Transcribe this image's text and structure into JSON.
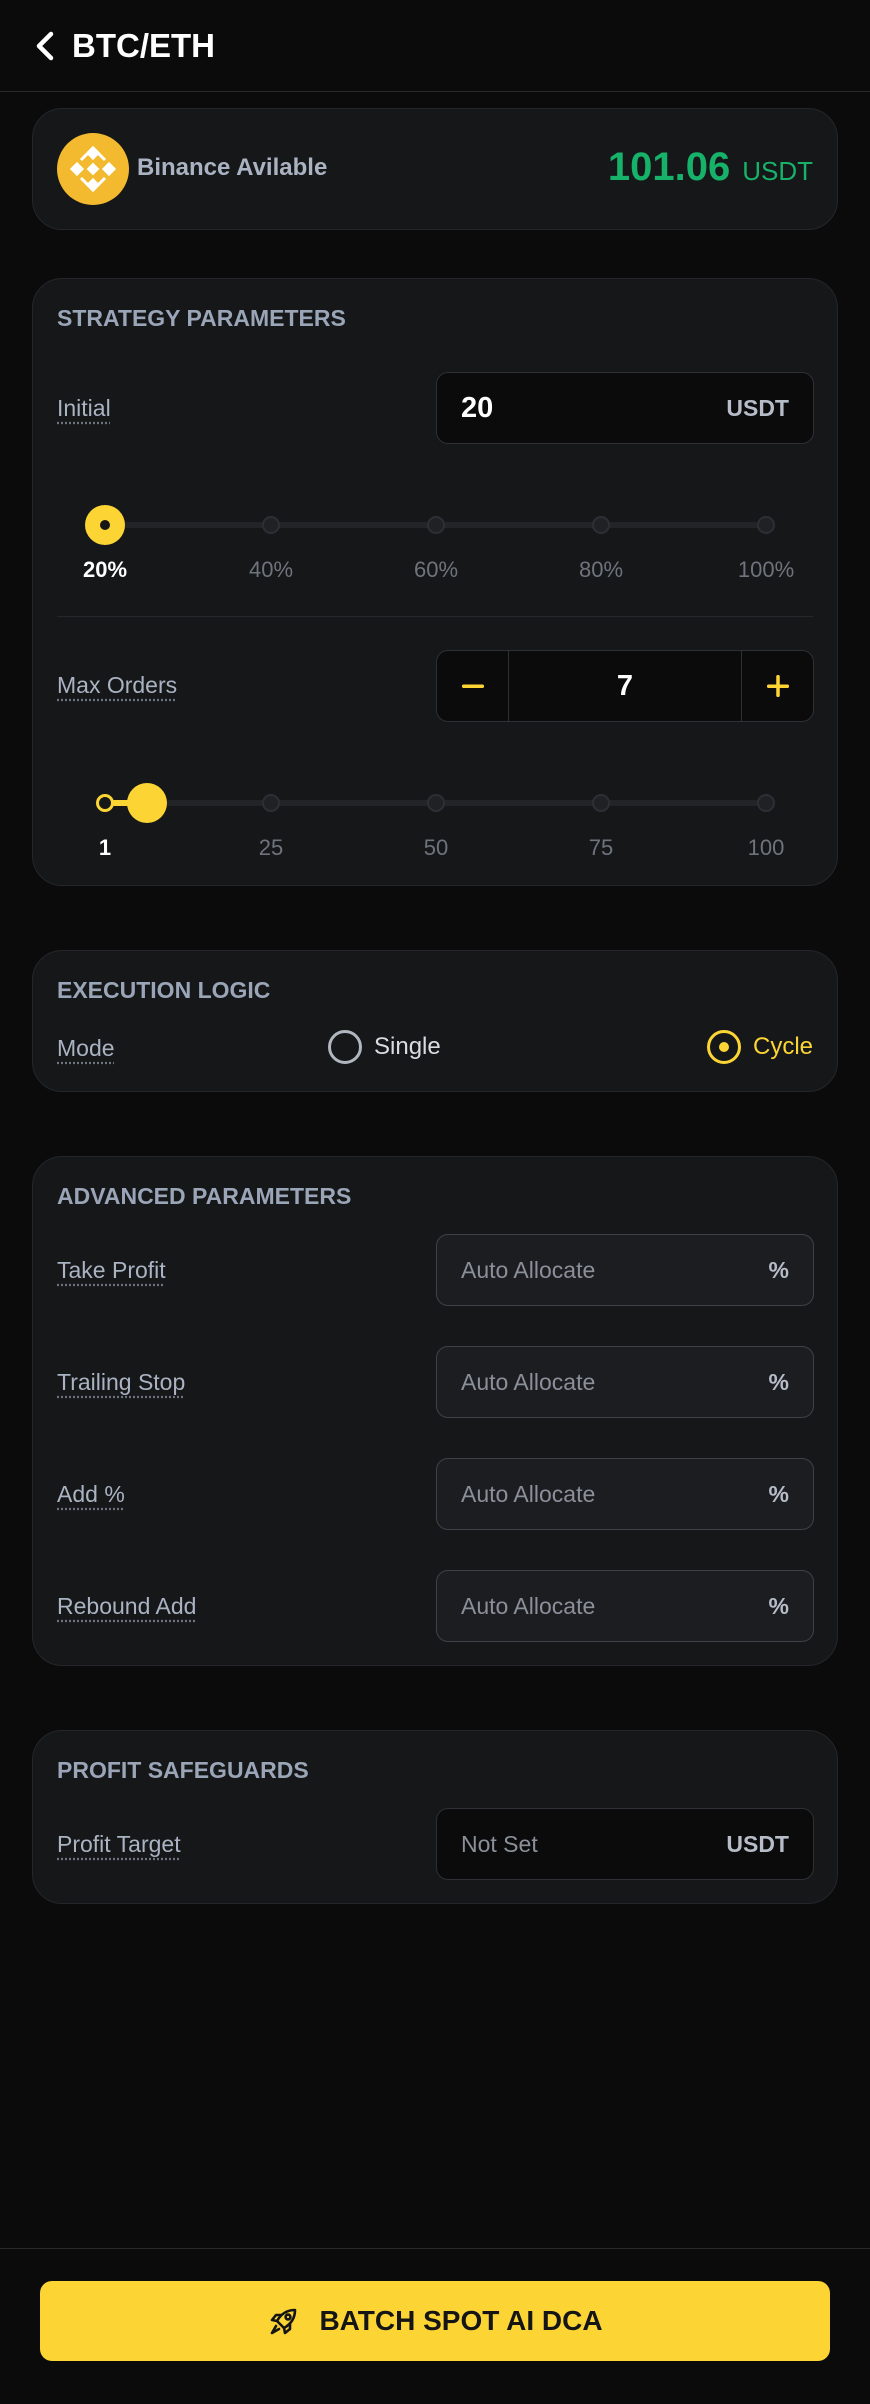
{
  "header": {
    "title": "BTC/ETH",
    "back_icon": "chevron-left-icon"
  },
  "balance": {
    "exchange_label": "Binance Avilable",
    "logo_icon": "binance-logo-icon",
    "amount": "101.06",
    "currency": "USDT",
    "amount_color": "#17b26a"
  },
  "strategy": {
    "title": "STRATEGY PARAMETERS",
    "initial": {
      "label": "Initial",
      "value": "20",
      "suffix": "USDT"
    },
    "initial_slider": {
      "stops": [
        "20%",
        "40%",
        "60%",
        "80%",
        "100%"
      ],
      "selected_index": 0
    },
    "max_orders": {
      "label": "Max Orders",
      "value": "7",
      "minus_icon": "minus-icon",
      "plus_icon": "plus-icon"
    },
    "orders_slider": {
      "stops": [
        "1",
        "25",
        "50",
        "75",
        "100"
      ],
      "min": 1,
      "max": 100,
      "value": 7
    }
  },
  "execution": {
    "title": "EXECUTION LOGIC",
    "mode_label": "Mode",
    "options": [
      "Single",
      "Cycle"
    ],
    "selected": "Cycle"
  },
  "advanced": {
    "title": "ADVANCED PARAMETERS",
    "fields": [
      {
        "label": "Take Profit",
        "placeholder": "Auto Allocate",
        "suffix": "%"
      },
      {
        "label": "Trailing Stop",
        "placeholder": "Auto Allocate",
        "suffix": "%"
      },
      {
        "label": "Add %",
        "placeholder": "Auto Allocate",
        "suffix": "%"
      },
      {
        "label": "Rebound Add",
        "placeholder": "Auto Allocate",
        "suffix": "%"
      }
    ]
  },
  "safeguards": {
    "title": "PROFIT SAFEGUARDS",
    "profit_target": {
      "label": "Profit Target",
      "placeholder": "Not Set",
      "suffix": "USDT"
    }
  },
  "footer": {
    "cta_label": "BATCH SPOT AI DCA",
    "cta_icon": "rocket-icon"
  },
  "colors": {
    "accent": "#fcd535",
    "background": "#0b0b0c",
    "card": "#161719"
  }
}
